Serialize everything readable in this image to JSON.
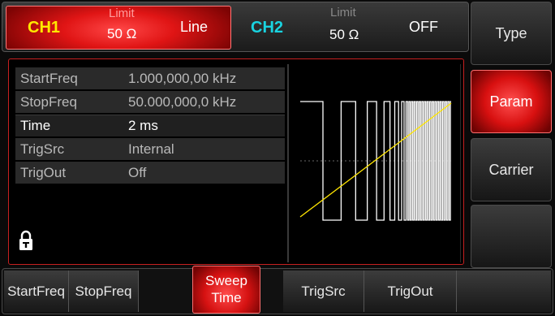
{
  "ch1": {
    "label": "CH1",
    "limit_label": "Limit",
    "impedance": "50 Ω",
    "mode": "Line"
  },
  "ch2": {
    "label": "CH2",
    "limit_label": "Limit",
    "impedance": "50 Ω",
    "mode": "OFF"
  },
  "params": [
    {
      "name": "StartFreq",
      "value": "1.000,000,00 kHz"
    },
    {
      "name": "StopFreq",
      "value": "50.000,000,0 kHz"
    },
    {
      "name": "Time",
      "value": "2 ms"
    },
    {
      "name": "TrigSrc",
      "value": "Internal"
    },
    {
      "name": "TrigOut",
      "value": "Off"
    }
  ],
  "right_menu": [
    {
      "label": "Type"
    },
    {
      "label": "Param"
    },
    {
      "label": "Carrier"
    },
    {
      "label": ""
    }
  ],
  "bottom_menu": [
    {
      "line1": "StartFreq",
      "line2": ""
    },
    {
      "line1": "StopFreq",
      "line2": ""
    },
    {
      "line1": "Sweep",
      "line2": "Time"
    },
    {
      "line1": "TrigSrc",
      "line2": ""
    },
    {
      "line1": "TrigOut",
      "line2": ""
    },
    {
      "line1": "",
      "line2": ""
    }
  ],
  "icons": {
    "lock": "lock-icon"
  },
  "colors": {
    "ch1_label": "#ffe900",
    "ch2_label": "#19d3e0",
    "active_key": "#d81010",
    "sweep_line": "#ffe600"
  }
}
